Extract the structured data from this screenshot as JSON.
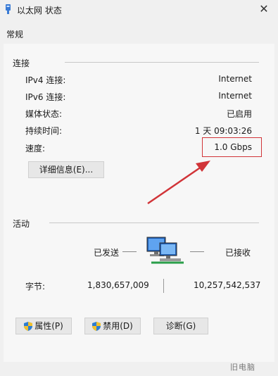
{
  "window": {
    "title": "以太网 状态",
    "close_glyph": "✕"
  },
  "tab": {
    "label": "常规"
  },
  "connection": {
    "title": "连接",
    "rows": [
      {
        "label": "IPv4 连接:",
        "value": "Internet"
      },
      {
        "label": "IPv6 连接:",
        "value": "Internet"
      },
      {
        "label": "媒体状态:",
        "value": "已启用"
      },
      {
        "label": "持续时间:",
        "value": "1 天 09:03:26"
      },
      {
        "label": "速度:",
        "value": "1.0 Gbps"
      }
    ],
    "details_button": "详细信息(E)..."
  },
  "activity": {
    "title": "活动",
    "sent_label": "已发送",
    "received_label": "已接收",
    "bytes_label": "字节:",
    "sent_bytes": "1,830,657,009",
    "received_bytes": "10,257,542,537"
  },
  "buttons": {
    "properties": "属性(P)",
    "disable": "禁用(D)",
    "diagnose": "诊断(G)"
  },
  "watermark": "旧电脑",
  "colors": {
    "highlight": "#d13438",
    "arrow": "#d13438"
  }
}
